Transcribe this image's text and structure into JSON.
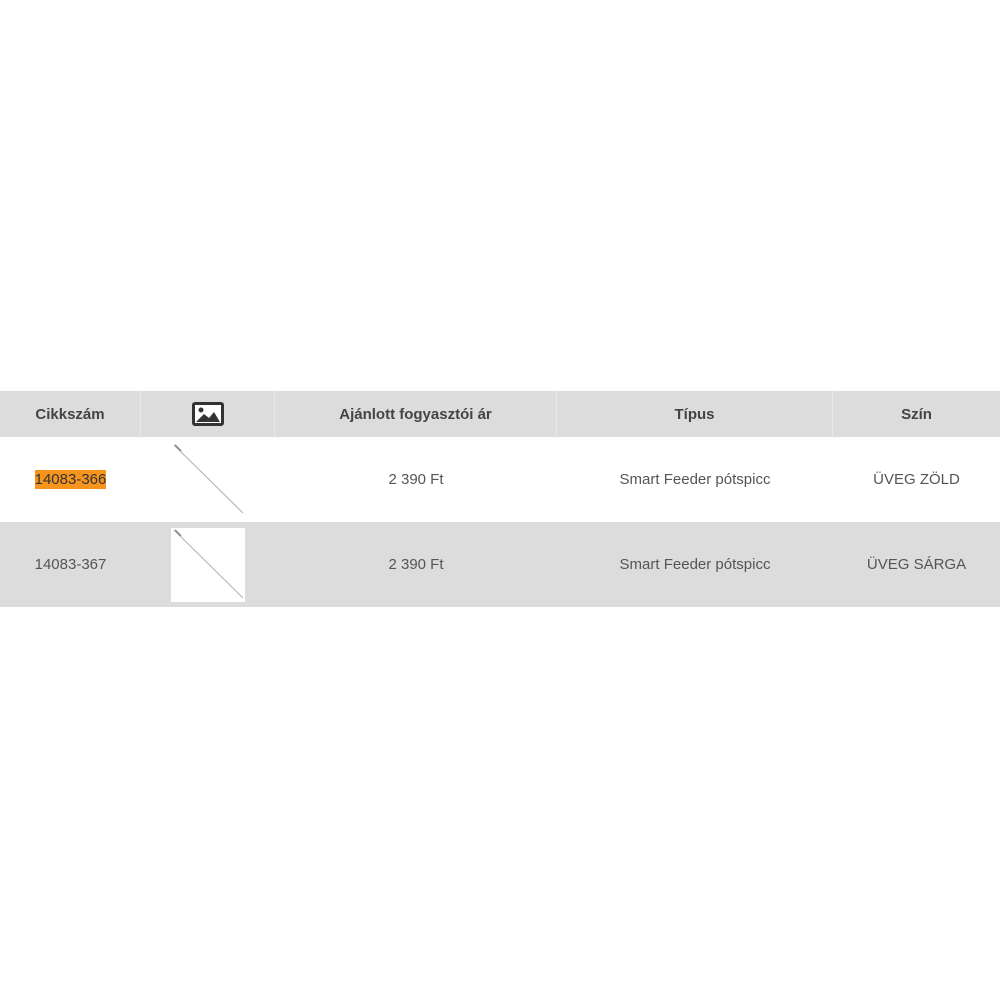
{
  "table": {
    "headers": {
      "sku": "Cikkszám",
      "image_icon": "image-icon",
      "price": "Ajánlott fogyasztói ár",
      "type": "Típus",
      "color": "Szín"
    },
    "rows": [
      {
        "sku": "14083-366",
        "highlighted": true,
        "price": "2 390 Ft",
        "type": "Smart Feeder pótspicc",
        "color": "ÜVEG ZÖLD"
      },
      {
        "sku": "14083-367",
        "highlighted": false,
        "price": "2 390 Ft",
        "type": "Smart Feeder pótspicc",
        "color": "ÜVEG SÁRGA"
      }
    ]
  },
  "colors": {
    "header_bg": "#dcdcdc",
    "highlight": "#f7941d"
  }
}
